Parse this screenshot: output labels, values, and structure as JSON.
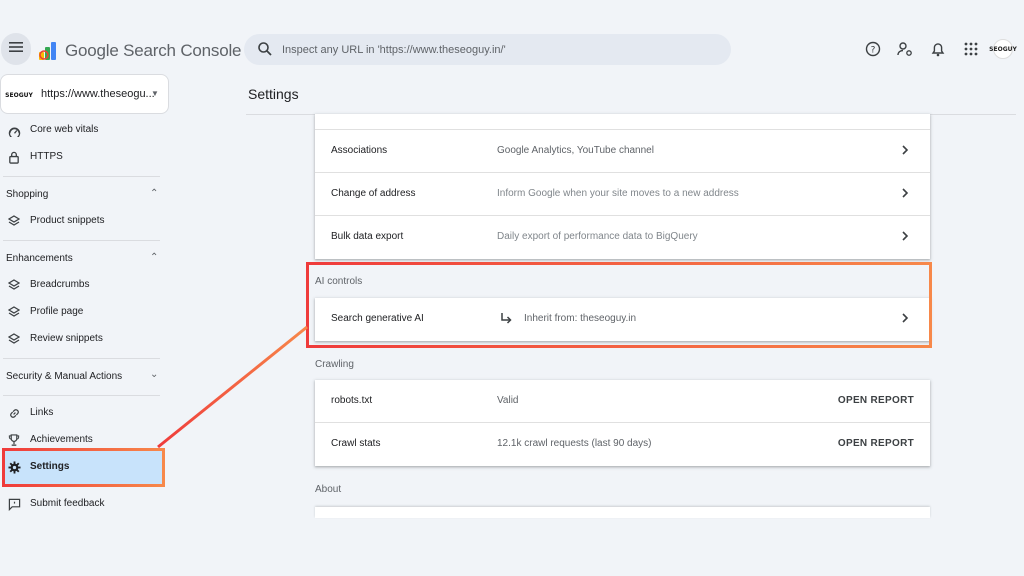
{
  "header": {
    "app_title": "Google Search Console",
    "search_placeholder": "Inspect any URL in 'https://www.theseoguy.in/'",
    "icons": [
      "menu-icon",
      "help-icon",
      "manage-users-icon",
      "notifications-icon",
      "apps-grid-icon"
    ],
    "avatar_text": "SEOGUY"
  },
  "sidebar": {
    "property": {
      "label": "https://www.theseogu...",
      "logo_text": "SEOGUY"
    },
    "items": [
      {
        "label": "Core web vitals",
        "icon": "gauge-icon"
      },
      {
        "label": "HTTPS",
        "icon": "lock-icon"
      }
    ],
    "shopping": {
      "title": "Shopping",
      "items": [
        {
          "label": "Product snippets",
          "icon": "layers-icon"
        }
      ]
    },
    "enhancements": {
      "title": "Enhancements",
      "items": [
        {
          "label": "Breadcrumbs",
          "icon": "layers-icon"
        },
        {
          "label": "Profile page",
          "icon": "layers-icon"
        },
        {
          "label": "Review snippets",
          "icon": "layers-icon"
        }
      ]
    },
    "security": {
      "title": "Security & Manual Actions"
    },
    "bottom_items": [
      {
        "label": "Links",
        "icon": "link-icon"
      },
      {
        "label": "Achievements",
        "icon": "trophy-icon"
      },
      {
        "label": "Settings",
        "icon": "gear-icon",
        "active": true
      }
    ],
    "feedback": {
      "label": "Submit feedback",
      "icon": "feedback-icon"
    }
  },
  "main": {
    "page_title": "Settings",
    "general_rows": [
      {
        "label": "Associations",
        "value": "Google Analytics, YouTube channel"
      },
      {
        "label": "Change of address",
        "value": "Inform Google when your site moves to a new address"
      },
      {
        "label": "Bulk data export",
        "value": "Daily export of performance data to BigQuery"
      }
    ],
    "ai_controls": {
      "title": "AI controls",
      "row": {
        "label": "Search generative AI",
        "value": "Inherit from: theseoguy.in"
      }
    },
    "crawling": {
      "title": "Crawling",
      "rows": [
        {
          "label": "robots.txt",
          "value": "Valid",
          "action": "OPEN REPORT"
        },
        {
          "label": "Crawl stats",
          "value": "12.1k crawl requests (last 90 days)",
          "action": "OPEN REPORT"
        }
      ]
    },
    "about": {
      "title": "About"
    }
  },
  "colors": {
    "highlight_start": "#ef3b3b",
    "highlight_end": "#f7884a",
    "active_nav_bg": "#c8e3fb",
    "page_bg": "#f1f4f8"
  }
}
